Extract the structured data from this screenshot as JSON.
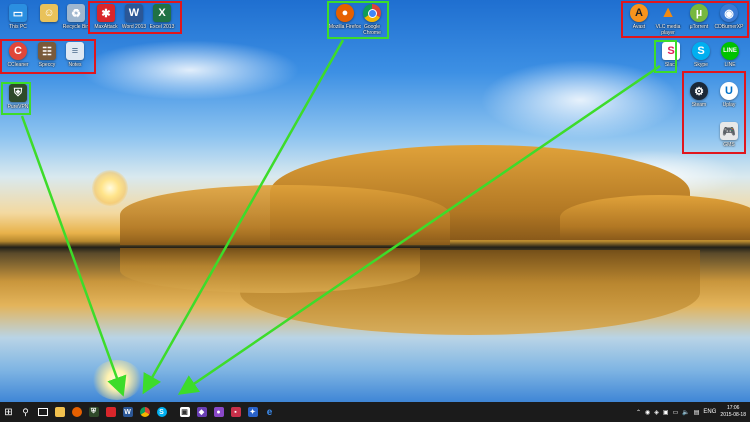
{
  "desktop": {
    "icons": {
      "this_pc": "This PC",
      "user": "",
      "recycle_bin": "Recycle Bin",
      "zboard": "MaxAttack",
      "word": "Word 2013",
      "excel": "Excel 2013",
      "ccleaner": "CCleaner",
      "speccy": "Speccy",
      "notepad": "Notes",
      "pure_vpn": "PureVPN",
      "firefox": "Mozilla Firefox",
      "chrome": "Google Chrome",
      "avast": "Avast",
      "vlc": "VLC media player",
      "utorrent": "µTorrent",
      "cdburner": "CDBurnerXP",
      "slack": "Slack",
      "skype": "Skype",
      "line": "LINE",
      "steam": "Steam",
      "uplay": "Uplay",
      "gamepad": "GMS"
    }
  },
  "taskbar": {
    "search_icon": "⚲",
    "language": "ENG",
    "time": "17:06",
    "date": "2015-08-18"
  },
  "colors": {
    "annotation_red": "#e0161d",
    "annotation_green": "#3ddc2a",
    "taskbar_bg": "#1b1b1b"
  }
}
